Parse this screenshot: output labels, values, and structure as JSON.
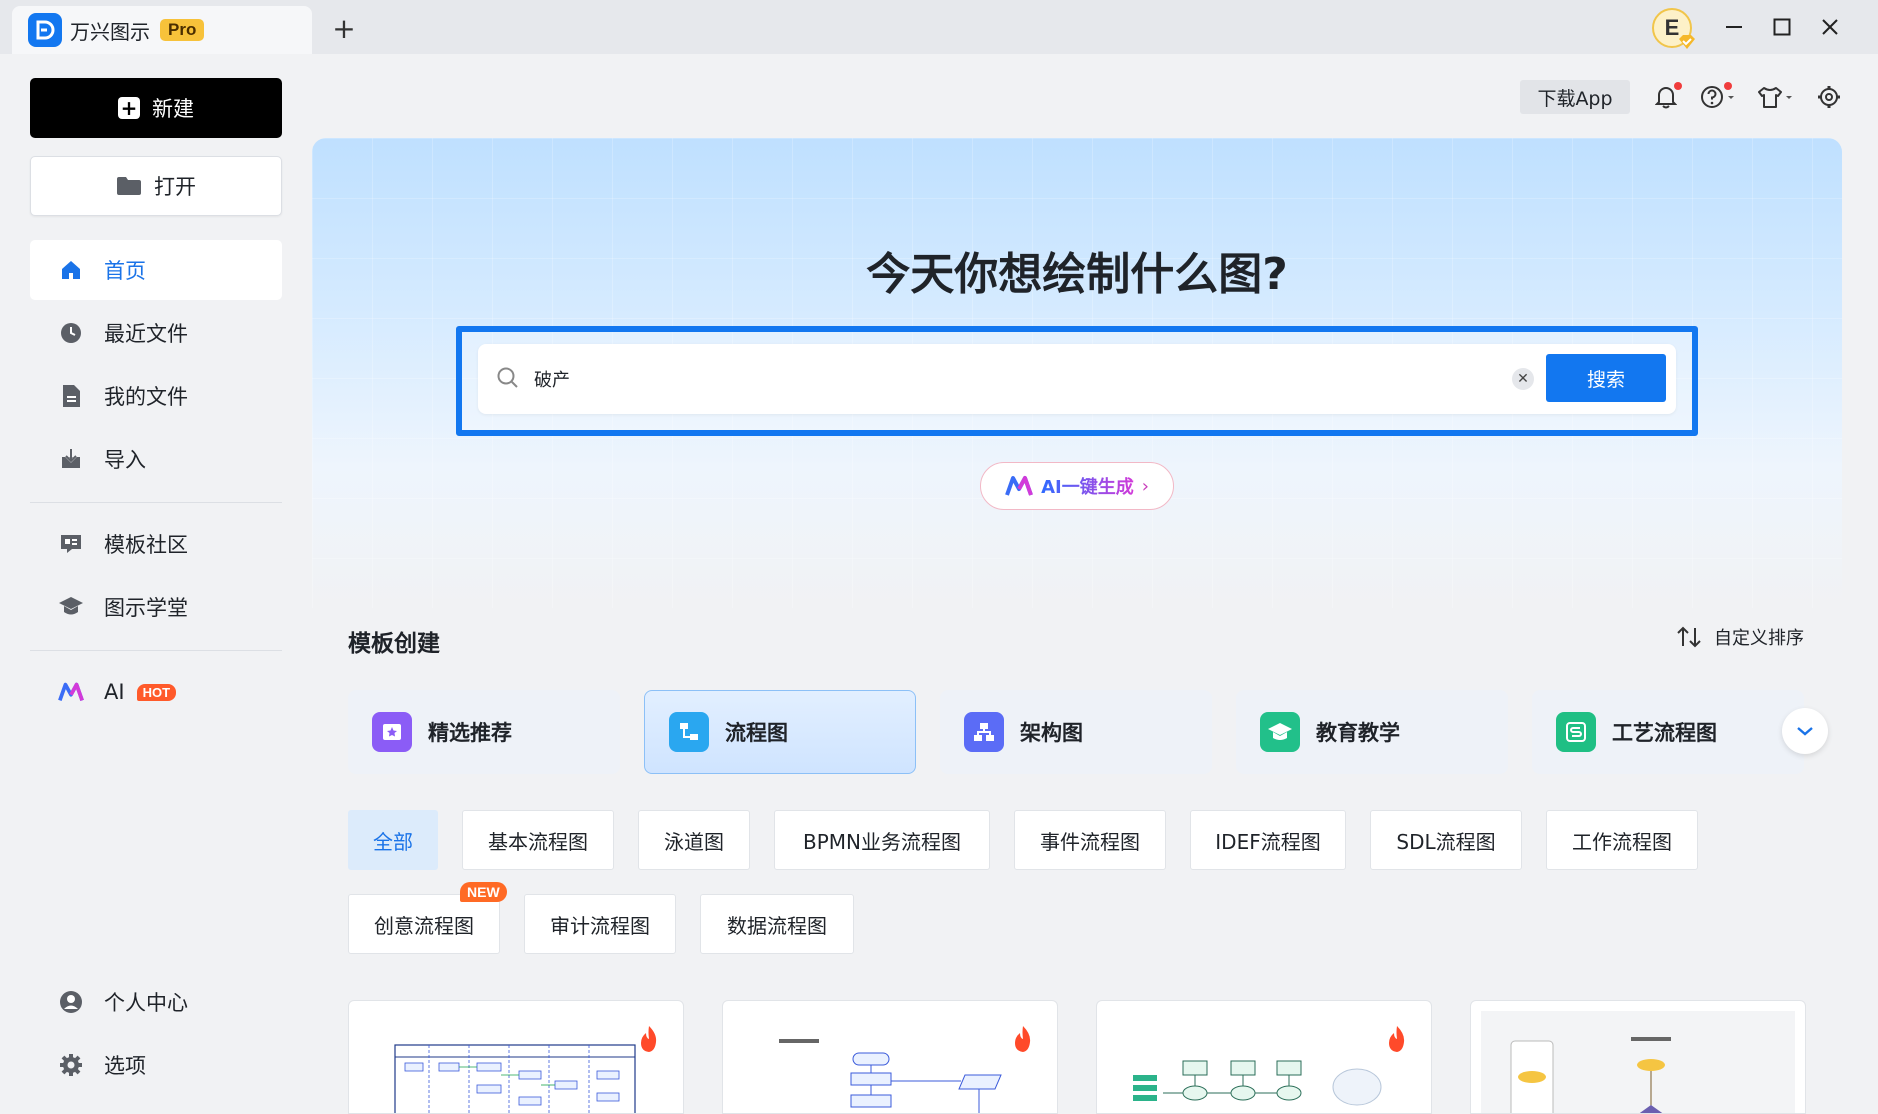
{
  "window": {
    "app_name": "万兴图示",
    "edition_badge": "Pro",
    "user_initial": "E"
  },
  "sidebar": {
    "new_label": "新建",
    "open_label": "打开",
    "nav": [
      {
        "label": "首页",
        "active": true
      },
      {
        "label": "最近文件"
      },
      {
        "label": "我的文件"
      },
      {
        "label": "导入"
      },
      {
        "label": "模板社区"
      },
      {
        "label": "图示学堂"
      },
      {
        "label": "AI",
        "badge": "HOT"
      },
      {
        "label": "个人中心"
      },
      {
        "label": "选项"
      }
    ]
  },
  "toolbar": {
    "download_app": "下载App"
  },
  "hero": {
    "title": "今天你想绘制什么图?",
    "search_value": "破产",
    "search_button": "搜索",
    "ai_generate": "AI一键生成"
  },
  "templates": {
    "section_title": "模板创建",
    "sort_label": "自定义排序",
    "categories": [
      {
        "label": "精选推荐",
        "color": "#8b5cf6"
      },
      {
        "label": "流程图",
        "color": "#2aa7f0",
        "active": true
      },
      {
        "label": "架构图",
        "color": "#5b6cf6"
      },
      {
        "label": "教育教学",
        "color": "#22c08a"
      },
      {
        "label": "工艺流程图",
        "color": "#1fbf84"
      }
    ],
    "chips": [
      {
        "label": "全部",
        "active": true
      },
      {
        "label": "基本流程图"
      },
      {
        "label": "泳道图"
      },
      {
        "label": "BPMN业务流程图"
      },
      {
        "label": "事件流程图"
      },
      {
        "label": "IDEF流程图"
      },
      {
        "label": "SDL流程图"
      },
      {
        "label": "工作流程图"
      },
      {
        "label": "创意流程图",
        "badge": "NEW"
      },
      {
        "label": "审计流程图"
      },
      {
        "label": "数据流程图"
      }
    ]
  },
  "colors": {
    "accent": "#1277f0",
    "hot": "#ff5a2a"
  }
}
